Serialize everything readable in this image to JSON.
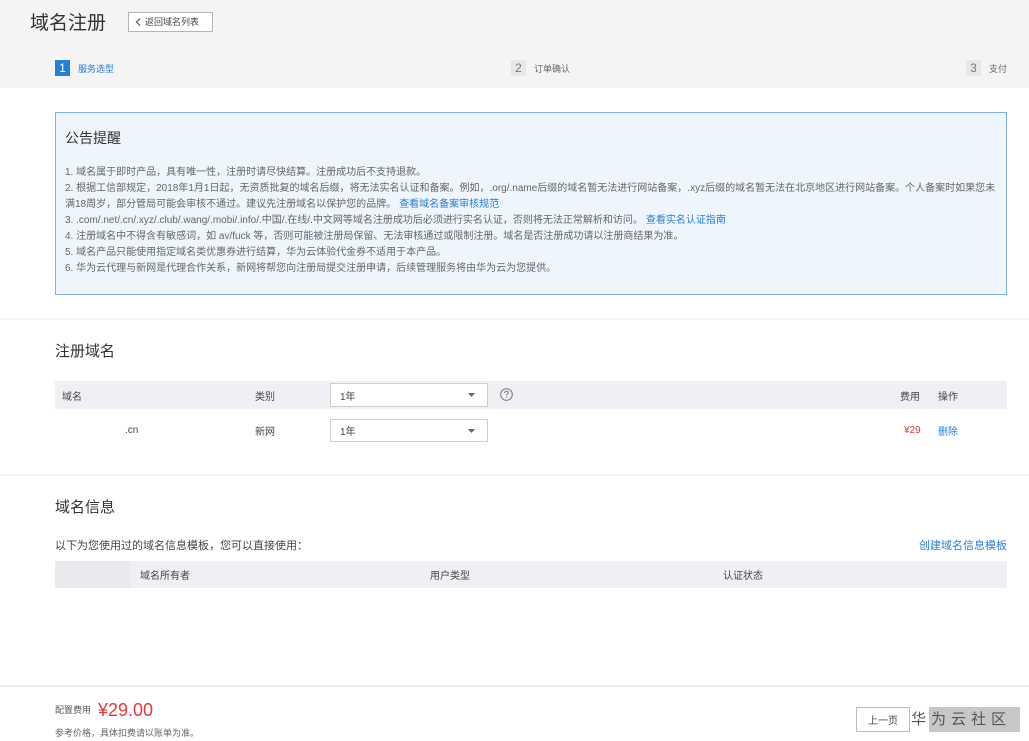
{
  "header": {
    "title": "域名注册",
    "back_label": "返回域名列表"
  },
  "steps": [
    {
      "num": "1",
      "label": "服务选型",
      "active": true
    },
    {
      "num": "2",
      "label": "订单确认",
      "active": false
    },
    {
      "num": "3",
      "label": "支付",
      "active": false
    }
  ],
  "notice": {
    "title": "公告提醒",
    "lines": [
      {
        "text": "1. 域名属于即时产品，具有唯一性，注册时请尽快结算。注册成功后不支持退款。"
      },
      {
        "text": "2. 根据工信部规定，2018年1月1日起，无资质批复的域名后缀，将无法实名认证和备案。例如，.org/.name后缀的域名暂无法进行网站备案，.xyz后缀的域名暂无法在北京地区进行网站备案。个人备案时如果您未满18周岁，部分管局可能会审核不通过。建议先注册域名以保护您的品牌。",
        "link": "查看域名备案审核规范"
      },
      {
        "text": "3. .com/.net/.cn/.xyz/.club/.wang/.mobi/.info/.中国/.在线/.中文网等域名注册成功后必须进行实名认证，否则将无法正常解析和访问。",
        "link": "查看实名认证指南"
      },
      {
        "text": "4. 注册域名中不得含有敏感词，如 av/fuck 等，否则可能被注册局保留、无法审核通过或限制注册。域名是否注册成功请以注册商结果为准。"
      },
      {
        "text": "5. 域名产品只能使用指定域名类优惠券进行结算，华为云体验代金券不适用于本产品。"
      },
      {
        "text": "6. 华为云代理与新网是代理合作关系，新网将帮您向注册局提交注册申请，后续管理服务将由华为云为您提供。"
      }
    ]
  },
  "register": {
    "title": "注册域名",
    "columns": {
      "domain": "域名",
      "category": "类别",
      "fee": "费用",
      "action": "操作"
    },
    "header_period": "1年",
    "rows": [
      {
        "domain": ".cn",
        "category": "新网",
        "period": "1年",
        "fee": "¥29",
        "action": "删除"
      }
    ]
  },
  "info": {
    "title": "域名信息",
    "hint": "以下为您使用过的域名信息模板，您可以直接使用：",
    "create_link": "创建域名信息模板",
    "columns": {
      "owner": "域名所有者",
      "user_type": "用户类型",
      "status": "认证状态"
    }
  },
  "footer": {
    "fee_label": "配置费用",
    "fee_value": "¥29.00",
    "note": "参考价格，具体扣费请以账单为准。",
    "prev_button": "上一页",
    "watermark": "华为云社区"
  },
  "icons": {
    "back": "chevron-left-icon",
    "select": "chevron-down-icon",
    "help": "help-icon"
  },
  "colors": {
    "primary": "#2680d8",
    "price": "#e4393c",
    "notice_border": "#7eb2e4",
    "notice_bg": "#eef5fc",
    "table_head": "#eef0f3"
  }
}
